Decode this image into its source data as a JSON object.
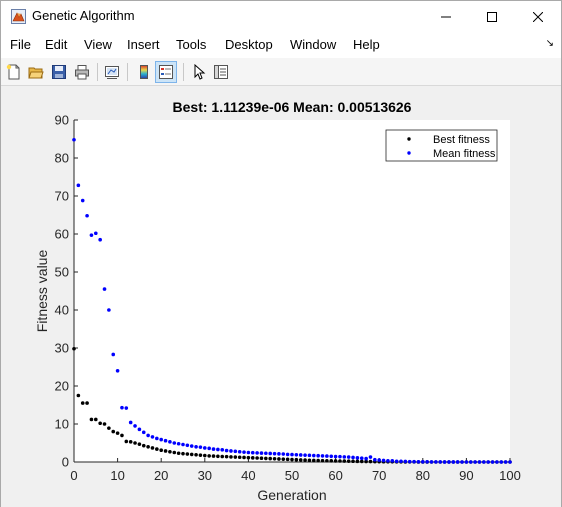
{
  "window": {
    "title": "Genetic Algorithm",
    "icon": "matlab-figure-icon",
    "controls": [
      "minimize-icon",
      "maximize-icon",
      "close-icon"
    ]
  },
  "menu": {
    "items": [
      "File",
      "Edit",
      "View",
      "Insert",
      "Tools",
      "Desktop",
      "Window",
      "Help"
    ],
    "dock_arrow": "↘"
  },
  "toolbar": {
    "buttons": [
      {
        "icon": "new-figure-icon"
      },
      {
        "icon": "open-file-icon"
      },
      {
        "icon": "save-icon"
      },
      {
        "icon": "print-icon"
      },
      {
        "icon": "link-plot-icon"
      },
      {
        "icon": "insert-colorbar-icon"
      },
      {
        "icon": "insert-legend-icon",
        "active": true
      },
      {
        "icon": "edit-plot-icon"
      },
      {
        "icon": "property-inspector-icon"
      }
    ]
  },
  "chart_data": {
    "type": "scatter",
    "title": "Best: 1.11239e-06 Mean: 0.00513626",
    "xlabel": "Generation",
    "ylabel": "Fitness value",
    "xlim": [
      0,
      100
    ],
    "ylim": [
      0,
      90
    ],
    "xticks": [
      0,
      10,
      20,
      30,
      40,
      50,
      60,
      70,
      80,
      90,
      100
    ],
    "yticks": [
      0,
      10,
      20,
      30,
      40,
      50,
      60,
      70,
      80,
      90
    ],
    "grid": false,
    "legend_position": "top-right",
    "series": [
      {
        "name": "Best fitness",
        "color": "#000000",
        "x": [
          0,
          1,
          2,
          3,
          4,
          5,
          6,
          7,
          8,
          9,
          10,
          11,
          12,
          13,
          14,
          15,
          16,
          17,
          18,
          19,
          20,
          21,
          22,
          23,
          24,
          25,
          26,
          27,
          28,
          29,
          30,
          31,
          32,
          33,
          34,
          35,
          36,
          37,
          38,
          39,
          40,
          41,
          42,
          43,
          44,
          45,
          46,
          47,
          48,
          49,
          50,
          51,
          52,
          53,
          54,
          55,
          56,
          57,
          58,
          59,
          60,
          61,
          62,
          63,
          64,
          65,
          66,
          67,
          68,
          69,
          70,
          71,
          72,
          73,
          74,
          75,
          76,
          77,
          78,
          79,
          80,
          81,
          82,
          83,
          84,
          85,
          86,
          87,
          88,
          89,
          90,
          91,
          92,
          93,
          94,
          95,
          96,
          97,
          98,
          99,
          100
        ],
        "values": [
          29.8,
          17.5,
          15.5,
          15.5,
          11.2,
          11.2,
          10.2,
          10.0,
          8.9,
          8.0,
          7.6,
          7.0,
          5.4,
          5.3,
          5.0,
          4.7,
          4.3,
          4.0,
          3.7,
          3.4,
          3.1,
          2.9,
          2.7,
          2.5,
          2.3,
          2.2,
          2.1,
          2.0,
          1.9,
          1.8,
          1.7,
          1.6,
          1.55,
          1.5,
          1.45,
          1.4,
          1.35,
          1.3,
          1.25,
          1.2,
          1.15,
          1.1,
          1.05,
          1.0,
          0.95,
          0.9,
          0.85,
          0.8,
          0.75,
          0.7,
          0.65,
          0.6,
          0.55,
          0.5,
          0.45,
          0.4,
          0.38,
          0.35,
          0.33,
          0.3,
          0.28,
          0.26,
          0.24,
          0.22,
          0.2,
          0.18,
          0.16,
          0.14,
          0.12,
          0.1,
          0.09,
          0.08,
          0.07,
          0.06,
          0.05,
          0.04,
          0.03,
          0.02,
          0.02,
          0.01,
          0.01,
          0.01,
          0.0,
          0.0,
          0.0,
          0.0,
          0.0,
          0.0,
          0.0,
          0.0,
          0.0,
          0.0,
          0.0,
          0.0,
          0.0,
          0.0,
          0.0,
          0.0,
          0.0,
          0.0,
          0.0
        ]
      },
      {
        "name": "Mean fitness",
        "color": "#0000ff",
        "x": [
          0,
          1,
          2,
          3,
          4,
          5,
          6,
          7,
          8,
          9,
          10,
          11,
          12,
          13,
          14,
          15,
          16,
          17,
          18,
          19,
          20,
          21,
          22,
          23,
          24,
          25,
          26,
          27,
          28,
          29,
          30,
          31,
          32,
          33,
          34,
          35,
          36,
          37,
          38,
          39,
          40,
          41,
          42,
          43,
          44,
          45,
          46,
          47,
          48,
          49,
          50,
          51,
          52,
          53,
          54,
          55,
          56,
          57,
          58,
          59,
          60,
          61,
          62,
          63,
          64,
          65,
          66,
          67,
          68,
          69,
          70,
          71,
          72,
          73,
          74,
          75,
          76,
          77,
          78,
          79,
          80,
          81,
          82,
          83,
          84,
          85,
          86,
          87,
          88,
          89,
          90,
          91,
          92,
          93,
          94,
          95,
          96,
          97,
          98,
          99,
          100
        ],
        "values": [
          84.8,
          72.8,
          68.8,
          64.8,
          59.7,
          60.2,
          58.5,
          45.5,
          40.0,
          28.3,
          24.0,
          14.3,
          14.2,
          10.4,
          9.5,
          8.6,
          7.8,
          7.0,
          6.6,
          6.2,
          5.9,
          5.6,
          5.3,
          5.0,
          4.8,
          4.6,
          4.4,
          4.2,
          4.0,
          3.9,
          3.7,
          3.6,
          3.4,
          3.3,
          3.2,
          3.0,
          2.9,
          2.8,
          2.7,
          2.6,
          2.5,
          2.45,
          2.4,
          2.35,
          2.3,
          2.25,
          2.2,
          2.15,
          2.1,
          2.0,
          1.95,
          1.9,
          1.85,
          1.8,
          1.75,
          1.7,
          1.65,
          1.6,
          1.55,
          1.5,
          1.45,
          1.4,
          1.35,
          1.3,
          1.2,
          1.1,
          1.0,
          0.9,
          1.3,
          0.6,
          0.5,
          0.4,
          0.3,
          0.3,
          0.2,
          0.2,
          0.15,
          0.1,
          0.1,
          0.05,
          0.05,
          0.05,
          0.02,
          0.02,
          0.02,
          0.01,
          0.01,
          0.01,
          0.01,
          0.0,
          0.0,
          0.0,
          0.0,
          0.0,
          0.0,
          0.0,
          0.0,
          0.0,
          0.0,
          0.0,
          0.0
        ]
      }
    ]
  }
}
